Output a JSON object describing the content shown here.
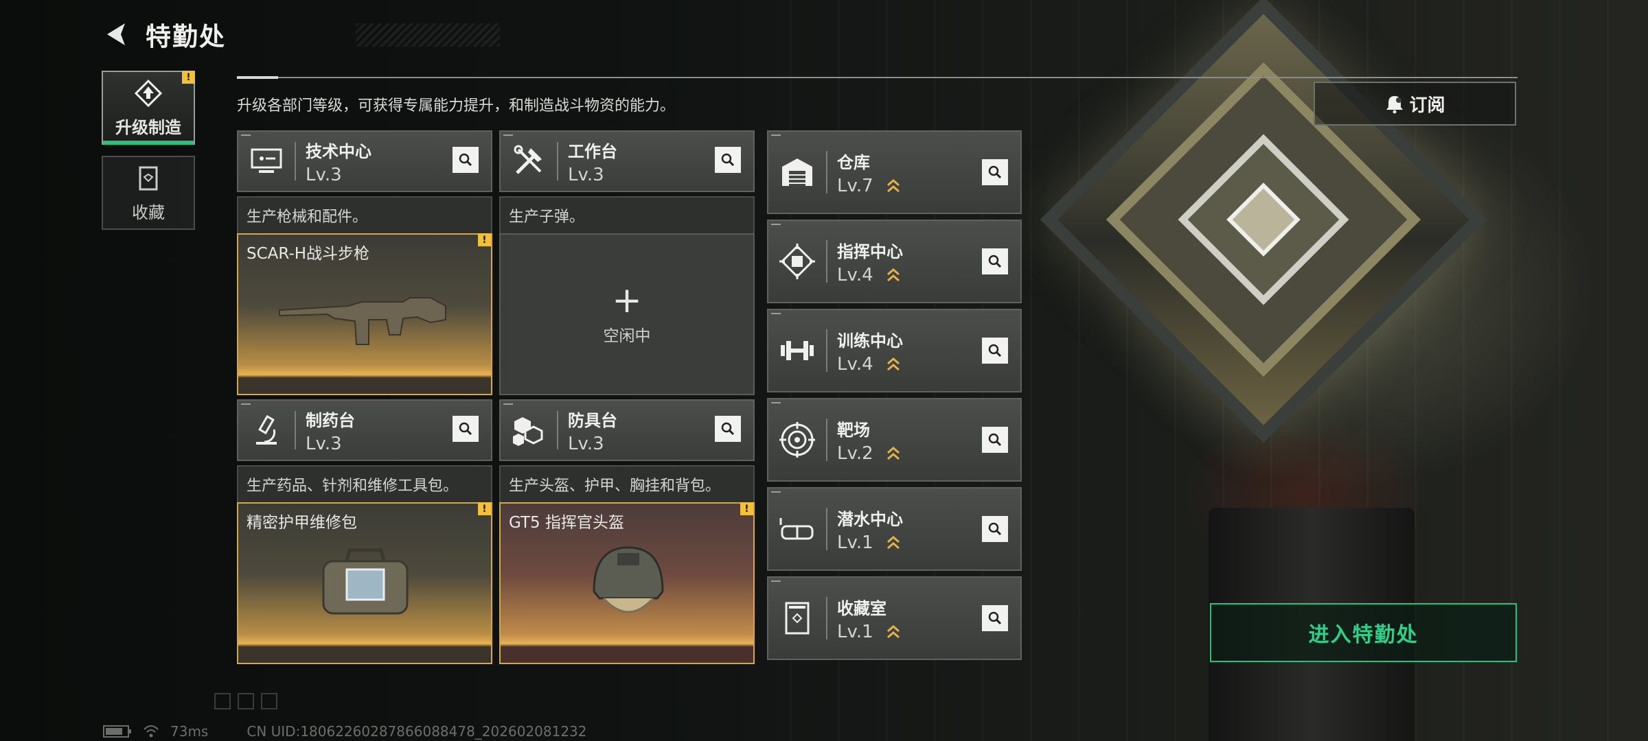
{
  "header": {
    "title": "特勤处"
  },
  "sidebar": {
    "tabs": [
      {
        "label": "升级制造",
        "active": true,
        "alert": "!"
      },
      {
        "label": "收藏",
        "active": false
      }
    ]
  },
  "description": "升级各部门等级，可获得专属能力提升，和制造战斗物资的能力。",
  "workbenches": [
    {
      "name": "技术中心",
      "level": "Lv.3",
      "desc": "生产枪械和配件。",
      "slot": {
        "state": "producing",
        "item": "SCAR-H战斗步枪",
        "alert": "!"
      }
    },
    {
      "name": "工作台",
      "level": "Lv.3",
      "desc": "生产子弹。",
      "slot": {
        "state": "idle",
        "plus": "+",
        "label": "空闲中"
      }
    },
    {
      "name": "制药台",
      "level": "Lv.3",
      "desc": "生产药品、针剂和维修工具包。",
      "slot": {
        "state": "producing",
        "item": "精密护甲维修包",
        "alert": "!"
      }
    },
    {
      "name": "防具台",
      "level": "Lv.3",
      "desc": "生产头盔、护甲、胸挂和背包。",
      "slot": {
        "state": "producing",
        "item": "GT5 指挥官头盔",
        "alert": "!"
      }
    }
  ],
  "facilities": [
    {
      "name": "仓库",
      "level": "Lv.7",
      "icon": "warehouse-icon"
    },
    {
      "name": "指挥中心",
      "level": "Lv.4",
      "icon": "command-chip-icon"
    },
    {
      "name": "训练中心",
      "level": "Lv.4",
      "icon": "dumbbell-icon"
    },
    {
      "name": "靶场",
      "level": "Lv.2",
      "icon": "target-icon"
    },
    {
      "name": "潜水中心",
      "level": "Lv.1",
      "icon": "diving-goggles-icon"
    },
    {
      "name": "收藏室",
      "level": "Lv.1",
      "icon": "collection-room-icon"
    }
  ],
  "actions": {
    "subscribe": "订阅",
    "enter": "进入特勤处"
  },
  "status": {
    "ping": "73ms",
    "uid": "CN UID:1806226028786608847‌8_202602081232"
  },
  "colors": {
    "accent_green": "#2bbf7e",
    "alert_yellow": "#f2c03a",
    "upgrade_chevron": "#e3b347"
  }
}
